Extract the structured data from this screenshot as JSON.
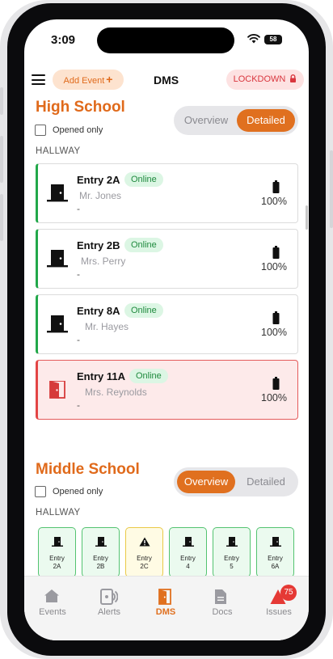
{
  "status_bar": {
    "time": "3:09",
    "battery_level": "58"
  },
  "top_bar": {
    "add_event_label": "Add Event",
    "title": "DMS",
    "lockdown_label": "LOCKDOWN"
  },
  "schools": [
    {
      "name": "High School",
      "opened_only_label": "Opened only",
      "toggle": {
        "overview": "Overview",
        "detailed": "Detailed",
        "active": "Detailed"
      },
      "section": "HALLWAY",
      "entries": [
        {
          "name": "Entry 2A",
          "status": "Online",
          "person": "Mr. Jones",
          "note": "-",
          "battery": "100%",
          "door_state": "closed"
        },
        {
          "name": "Entry 2B",
          "status": "Online",
          "person": "Mrs. Perry",
          "note": "-",
          "battery": "100%",
          "door_state": "closed"
        },
        {
          "name": "Entry 8A",
          "status": "Online",
          "person": "Mr. Hayes",
          "note": "-",
          "battery": "100%",
          "door_state": "closed"
        },
        {
          "name": "Entry 11A",
          "status": "Online",
          "person": "Mrs. Reynolds",
          "note": "-",
          "battery": "100%",
          "door_state": "open"
        }
      ]
    },
    {
      "name": "Middle School",
      "opened_only_label": "Opened only",
      "toggle": {
        "overview": "Overview",
        "detailed": "Detailed",
        "active": "Overview"
      },
      "section": "HALLWAY",
      "tiles": [
        {
          "line1": "Entry",
          "line2": "2A",
          "state": "closed"
        },
        {
          "line1": "Entry",
          "line2": "2B",
          "state": "closed"
        },
        {
          "line1": "Entry",
          "line2": "2C",
          "state": "warning"
        },
        {
          "line1": "Entry",
          "line2": "4",
          "state": "closed"
        },
        {
          "line1": "Entry",
          "line2": "5",
          "state": "closed"
        },
        {
          "line1": "Entry",
          "line2": "6A",
          "state": "closed"
        }
      ]
    }
  ],
  "tab_bar": {
    "tabs": [
      {
        "label": "Events",
        "icon": "home-icon"
      },
      {
        "label": "Alerts",
        "icon": "alerts-icon"
      },
      {
        "label": "DMS",
        "icon": "door-icon"
      },
      {
        "label": "Docs",
        "icon": "document-icon"
      },
      {
        "label": "Issues",
        "icon": "warning-icon"
      }
    ],
    "active": "DMS",
    "issues_badge": "75"
  },
  "colors": {
    "accent": "#e0701f",
    "online": "#22a84a",
    "alert": "#e34545",
    "warning": "#f0c63a"
  }
}
